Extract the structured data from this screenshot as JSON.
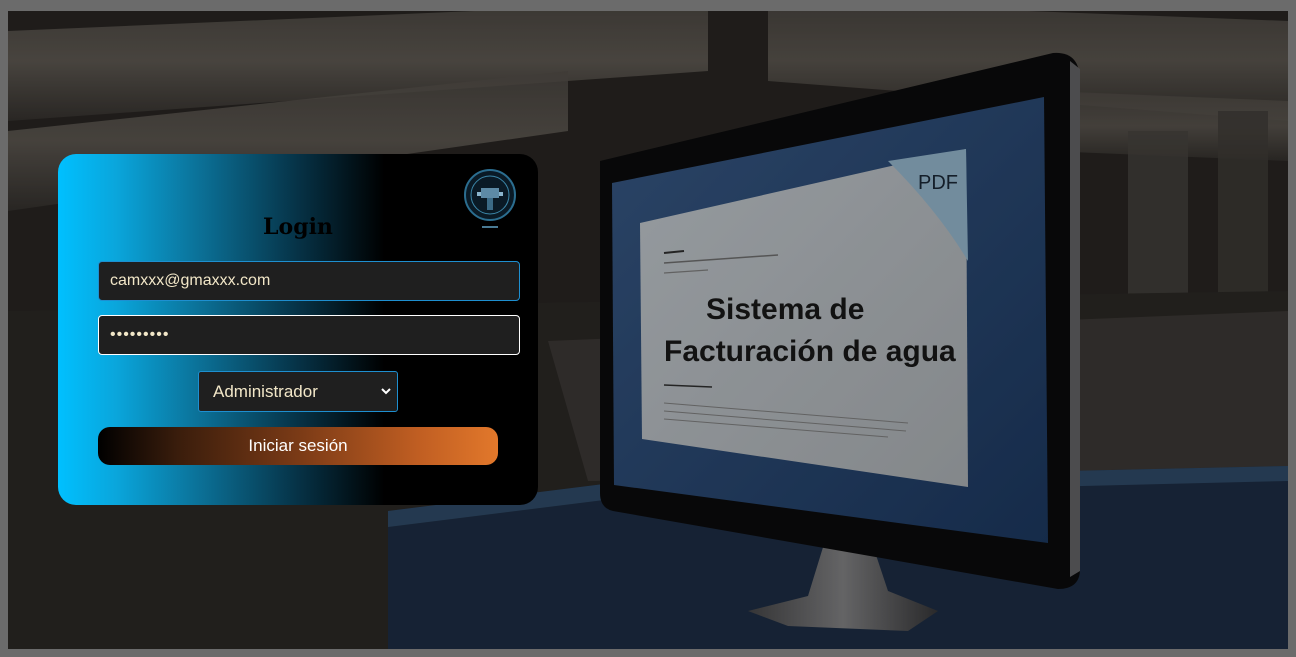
{
  "login": {
    "title": "Login",
    "email_value": "camxxx@gmaxxx.com",
    "password_value": "•••••••••",
    "role_selected": "Administrador",
    "submit_label": "Iniciar sesión"
  },
  "monitor": {
    "pdf_label": "PDF",
    "doc_title_line1": "Sistema de",
    "doc_title_line2": "Facturación de agua"
  },
  "colors": {
    "card_gradient_start": "#00c0ff",
    "button_gradient_end": "#e2782b",
    "input_border": "#1e8fd0"
  },
  "icons": {
    "logo": "water-company-seal-logo",
    "select_arrow": "chevron-down-icon"
  }
}
